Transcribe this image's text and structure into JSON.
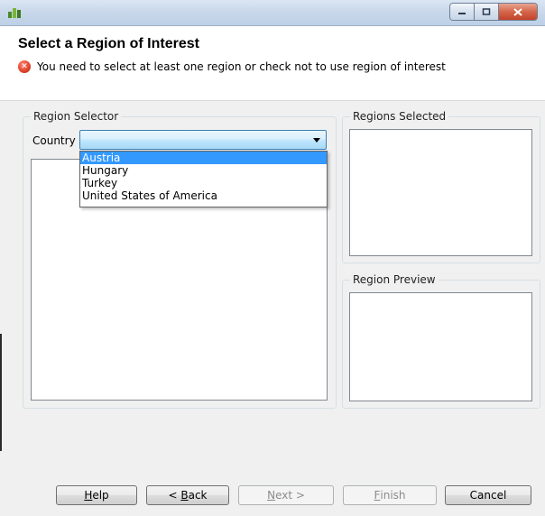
{
  "window": {
    "title": ""
  },
  "header": {
    "title": "Select a Region of Interest",
    "error_message": "You need to select at least one region or check not to use region of interest"
  },
  "region_selector": {
    "legend": "Region Selector",
    "country_label": "Country",
    "country_value": "",
    "country_options": [
      "Austria",
      "Hungary",
      "Turkey",
      "United States of America"
    ],
    "highlighted_option": "Austria"
  },
  "regions_selected": {
    "legend": "Regions Selected"
  },
  "region_preview": {
    "legend": "Region Preview"
  },
  "buttons": {
    "help": {
      "pre": "",
      "key": "H",
      "post": "elp"
    },
    "back": {
      "pre": "< ",
      "key": "B",
      "post": "ack"
    },
    "next": {
      "pre": "",
      "key": "N",
      "post": "ext >"
    },
    "finish": {
      "pre": "",
      "key": "F",
      "post": "inish"
    },
    "cancel": {
      "pre": "",
      "key": "",
      "post": "Cancel"
    }
  },
  "colors": {
    "title_bar": "#c9d8ea",
    "selection": "#3399ff",
    "error": "#e0452c",
    "combo_focus": "#3c7fb1"
  }
}
